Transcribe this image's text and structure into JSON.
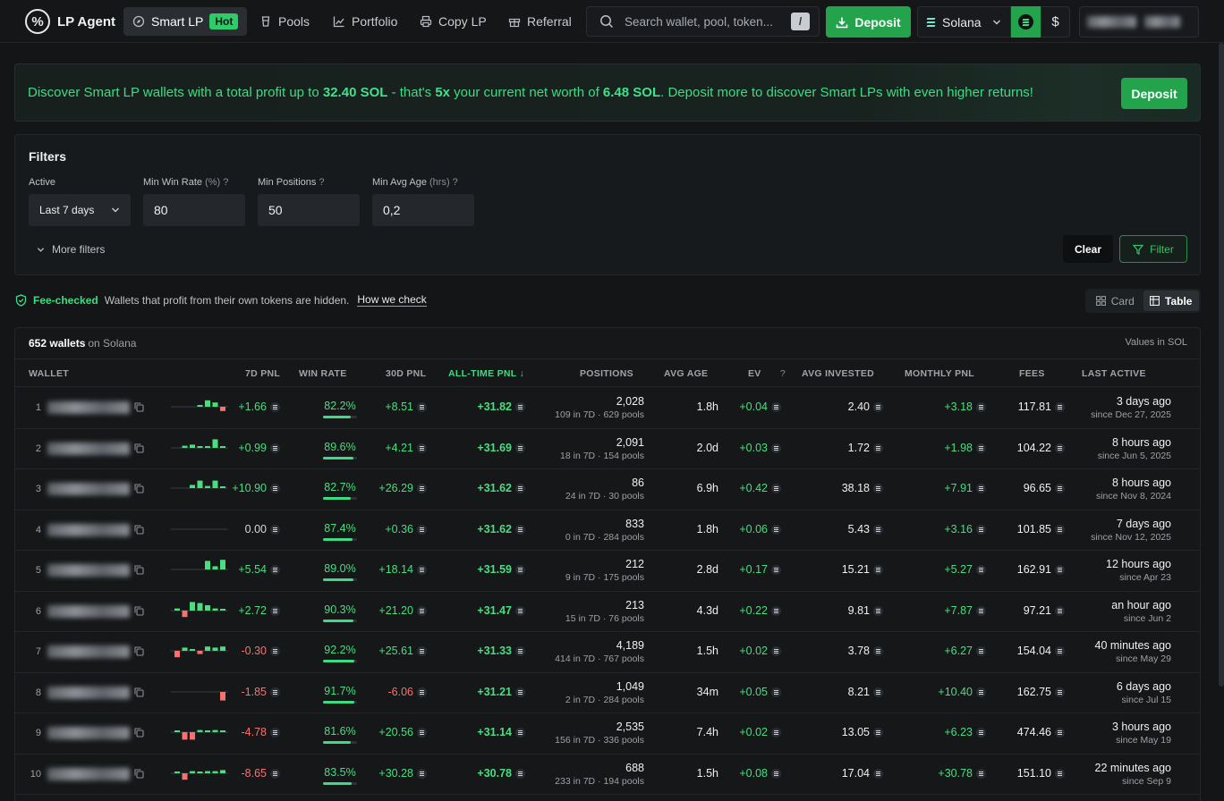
{
  "nav": {
    "brand": "LP Agent",
    "items": [
      {
        "label": "Smart LP",
        "badge": "Hot",
        "active": true
      },
      {
        "label": "Pools"
      },
      {
        "label": "Portfolio"
      },
      {
        "label": "Copy LP"
      },
      {
        "label": "Referral"
      }
    ],
    "search_placeholder": "Search wallet, pool, token...",
    "search_shortcut": "/",
    "deposit_label": "Deposit",
    "chain": "Solana",
    "currency_usd": "$"
  },
  "banner": {
    "pre": "Discover Smart LP wallets with a total profit up to ",
    "profit": "32.40 SOL",
    "mid1": " - that's ",
    "multiple": "5x",
    "mid2": " your current net worth of ",
    "networth": "6.48 SOL",
    "post": ". Deposit more to discover Smart LPs with even higher returns!",
    "button": "Deposit"
  },
  "filters": {
    "title": "Filters",
    "active_label": "Active",
    "active_value": "Last 7 days",
    "min_win_rate_label": "Min Win Rate",
    "min_win_rate_unit": "(%)",
    "min_win_rate_value": "80",
    "min_positions_label": "Min Positions",
    "min_positions_value": "50",
    "min_avg_age_label": "Min Avg Age",
    "min_avg_age_unit": "(hrs)",
    "min_avg_age_value": "0,2",
    "help_mark": "?",
    "more_filters": "More filters",
    "clear": "Clear",
    "filter": "Filter"
  },
  "fee_check": {
    "label": "Fee-checked",
    "desc": "Wallets that profit from their own tokens are hidden.",
    "link": "How we check"
  },
  "view_toggle": {
    "card": "Card",
    "table": "Table",
    "active": "table"
  },
  "table": {
    "count": "652 wallets",
    "chain_note": "on Solana",
    "values_note": "Values in SOL",
    "columns": [
      "WALLET",
      "7D PNL",
      "WIN RATE",
      "30D PNL",
      "ALL-TIME PNL",
      "POSITIONS",
      "AVG AGE",
      "EV",
      "AVG INVESTED",
      "MONTHLY PNL",
      "FEES",
      "LAST ACTIVE"
    ],
    "ev_help": "?",
    "sort_arrow": "↓",
    "rows": [
      {
        "idx": "1",
        "pnl7": "+1.66",
        "pnl7_sign": "pos",
        "spark": [
          0,
          0,
          0,
          0.1,
          0.6,
          0.4,
          -0.4
        ],
        "winrate": "82.2%",
        "wr": 82.2,
        "pnl30": "+8.51",
        "pnl30_sign": "pos",
        "pnlall": "+31.82",
        "positions": "2,028",
        "pos_detail": "109 in 7D · 629 pools",
        "avgage": "1.8h",
        "ev": "+0.04",
        "avginv": "2.40",
        "mpnl": "+3.18",
        "fees": "117.81",
        "last": "3 days ago",
        "since": "since Dec 27, 2025"
      },
      {
        "idx": "2",
        "pnl7": "+0.99",
        "pnl7_sign": "pos",
        "spark": [
          0,
          0.2,
          0.3,
          0.1,
          0.1,
          0.8,
          0.1
        ],
        "winrate": "89.6%",
        "wr": 89.6,
        "pnl30": "+4.21",
        "pnl30_sign": "pos",
        "pnlall": "+31.69",
        "positions": "2,091",
        "pos_detail": "18 in 7D · 154 pools",
        "avgage": "2.0d",
        "ev": "+0.03",
        "avginv": "1.72",
        "mpnl": "+1.98",
        "fees": "104.22",
        "last": "8 hours ago",
        "since": "since Jun 5, 2025"
      },
      {
        "idx": "3",
        "pnl7": "+10.90",
        "pnl7_sign": "pos",
        "spark": [
          0,
          0,
          0.3,
          0.7,
          0.2,
          0.7,
          0.1
        ],
        "winrate": "82.7%",
        "wr": 82.7,
        "pnl30": "+26.29",
        "pnl30_sign": "pos",
        "pnlall": "+31.62",
        "positions": "86",
        "pos_detail": "24 in 7D · 30 pools",
        "avgage": "6.9h",
        "ev": "+0.42",
        "avginv": "38.18",
        "mpnl": "+7.91",
        "fees": "96.65",
        "last": "8 hours ago",
        "since": "since Nov 8, 2024"
      },
      {
        "idx": "4",
        "pnl7": "0.00",
        "pnl7_sign": "neu",
        "spark": [],
        "winrate": "87.4%",
        "wr": 87.4,
        "pnl30": "+0.36",
        "pnl30_sign": "pos",
        "pnlall": "+31.62",
        "positions": "833",
        "pos_detail": "0 in 7D · 284 pools",
        "avgage": "1.8h",
        "ev": "+0.06",
        "avginv": "5.43",
        "mpnl": "+3.16",
        "fees": "101.85",
        "last": "7 days ago",
        "since": "since Nov 12, 2025"
      },
      {
        "idx": "5",
        "pnl7": "+5.54",
        "pnl7_sign": "pos",
        "spark": [
          0,
          0,
          0,
          0,
          0.8,
          0.3,
          0.9
        ],
        "winrate": "89.0%",
        "wr": 89.0,
        "pnl30": "+18.14",
        "pnl30_sign": "pos",
        "pnlall": "+31.59",
        "positions": "212",
        "pos_detail": "9 in 7D · 175 pools",
        "avgage": "2.8d",
        "ev": "+0.17",
        "avginv": "15.21",
        "mpnl": "+5.27",
        "fees": "162.91",
        "last": "12 hours ago",
        "since": "since Apr 23"
      },
      {
        "idx": "6",
        "pnl7": "+2.72",
        "pnl7_sign": "pos",
        "spark": [
          0.2,
          -0.6,
          0.8,
          0.7,
          0.5,
          0.2,
          0.1
        ],
        "winrate": "90.3%",
        "wr": 90.3,
        "pnl30": "+21.20",
        "pnl30_sign": "pos",
        "pnlall": "+31.47",
        "positions": "213",
        "pos_detail": "15 in 7D · 76 pools",
        "avgage": "4.3d",
        "ev": "+0.22",
        "avginv": "9.81",
        "mpnl": "+7.87",
        "fees": "97.21",
        "last": "an hour ago",
        "since": "since Jun 2"
      },
      {
        "idx": "7",
        "pnl7": "-0.30",
        "pnl7_sign": "neg",
        "spark": [
          -0.6,
          0.3,
          0.1,
          -0.3,
          0.4,
          0.3,
          0.4
        ],
        "winrate": "92.2%",
        "wr": 92.2,
        "pnl30": "+25.61",
        "pnl30_sign": "pos",
        "pnlall": "+31.33",
        "positions": "4,189",
        "pos_detail": "414 in 7D · 767 pools",
        "avgage": "1.5h",
        "ev": "+0.02",
        "avginv": "3.78",
        "mpnl": "+6.27",
        "fees": "154.04",
        "last": "40 minutes ago",
        "since": "since May 29"
      },
      {
        "idx": "8",
        "pnl7": "-1.85",
        "pnl7_sign": "neg",
        "spark": [
          0,
          0,
          0,
          0,
          0,
          0,
          -0.8
        ],
        "winrate": "91.7%",
        "wr": 91.7,
        "pnl30": "-6.06",
        "pnl30_sign": "neg",
        "pnlall": "+31.21",
        "positions": "1,049",
        "pos_detail": "2 in 7D · 284 pools",
        "avgage": "34m",
        "ev": "+0.05",
        "avginv": "8.21",
        "mpnl": "+10.40",
        "fees": "162.75",
        "last": "6 days ago",
        "since": "since Jul 15"
      },
      {
        "idx": "9",
        "pnl7": "-4.78",
        "pnl7_sign": "neg",
        "spark": [
          0.1,
          -0.7,
          -0.7,
          0.2,
          0.1,
          0.2,
          0.1
        ],
        "winrate": "81.6%",
        "wr": 81.6,
        "pnl30": "+20.56",
        "pnl30_sign": "pos",
        "pnlall": "+31.14",
        "positions": "2,535",
        "pos_detail": "156 in 7D · 336 pools",
        "avgage": "7.4h",
        "ev": "+0.02",
        "avginv": "13.05",
        "mpnl": "+6.23",
        "fees": "474.46",
        "last": "3 hours ago",
        "since": "since May 19"
      },
      {
        "idx": "10",
        "pnl7": "-8.65",
        "pnl7_sign": "neg",
        "spark": [
          0.1,
          -0.6,
          0.2,
          0.1,
          0.2,
          0.2,
          0.3
        ],
        "winrate": "83.5%",
        "wr": 83.5,
        "pnl30": "+30.28",
        "pnl30_sign": "pos",
        "pnlall": "+30.78",
        "positions": "688",
        "pos_detail": "233 in 7D · 194 pools",
        "avgage": "1.5h",
        "ev": "+0.08",
        "avginv": "17.04",
        "mpnl": "+30.78",
        "fees": "151.10",
        "last": "22 minutes ago",
        "since": "since Sep 9"
      }
    ]
  },
  "colors": {
    "accent": "#22a34c",
    "positive": "#4ade80",
    "negative": "#f87171"
  }
}
